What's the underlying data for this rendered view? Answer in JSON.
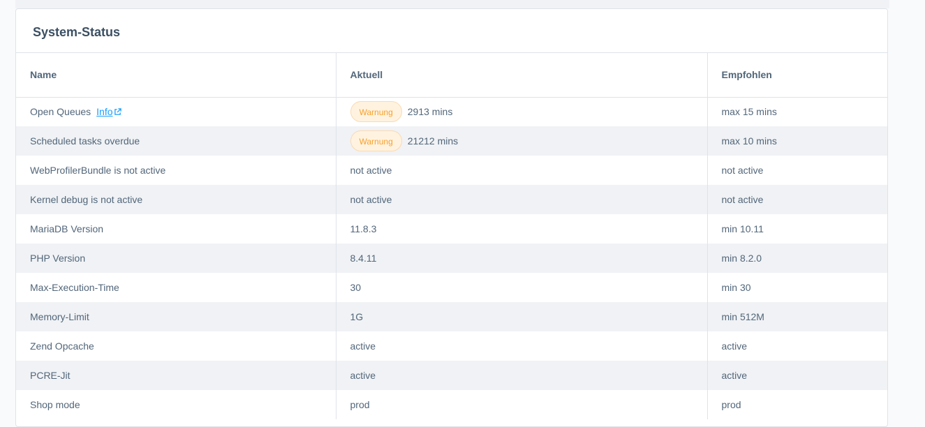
{
  "card": {
    "title": "System-Status"
  },
  "table": {
    "headers": [
      "Name",
      "Aktuell",
      "Empfohlen"
    ],
    "rows": [
      {
        "name": "Open Queues",
        "info": "Info",
        "badge": "Warnung",
        "current": "2913 mins",
        "recommended": "max 15 mins"
      },
      {
        "name": "Scheduled tasks overdue",
        "badge": "Warnung",
        "current": "21212 mins",
        "recommended": "max 10 mins"
      },
      {
        "name": "WebProfilerBundle is not active",
        "current": "not active",
        "recommended": "not active"
      },
      {
        "name": "Kernel debug is not active",
        "current": "not active",
        "recommended": "not active"
      },
      {
        "name": "MariaDB Version",
        "current": "11.8.3",
        "recommended": "min 10.11"
      },
      {
        "name": "PHP Version",
        "current": "8.4.11",
        "recommended": "min 8.2.0"
      },
      {
        "name": "Max-Execution-Time",
        "current": "30",
        "recommended": "min 30"
      },
      {
        "name": "Memory-Limit",
        "current": "1G",
        "recommended": "min 512M"
      },
      {
        "name": "Zend Opcache",
        "current": "active",
        "recommended": "active"
      },
      {
        "name": "PCRE-Jit",
        "current": "active",
        "recommended": "active"
      },
      {
        "name": "Shop mode",
        "current": "prod",
        "recommended": "prod"
      }
    ]
  },
  "colors": {
    "warning_text": "#f7a02e",
    "warning_bg": "#fff3e0",
    "link": "#189eff",
    "stripe": "#f0f2f5"
  },
  "icons": {
    "info_link": "external-link-icon"
  }
}
